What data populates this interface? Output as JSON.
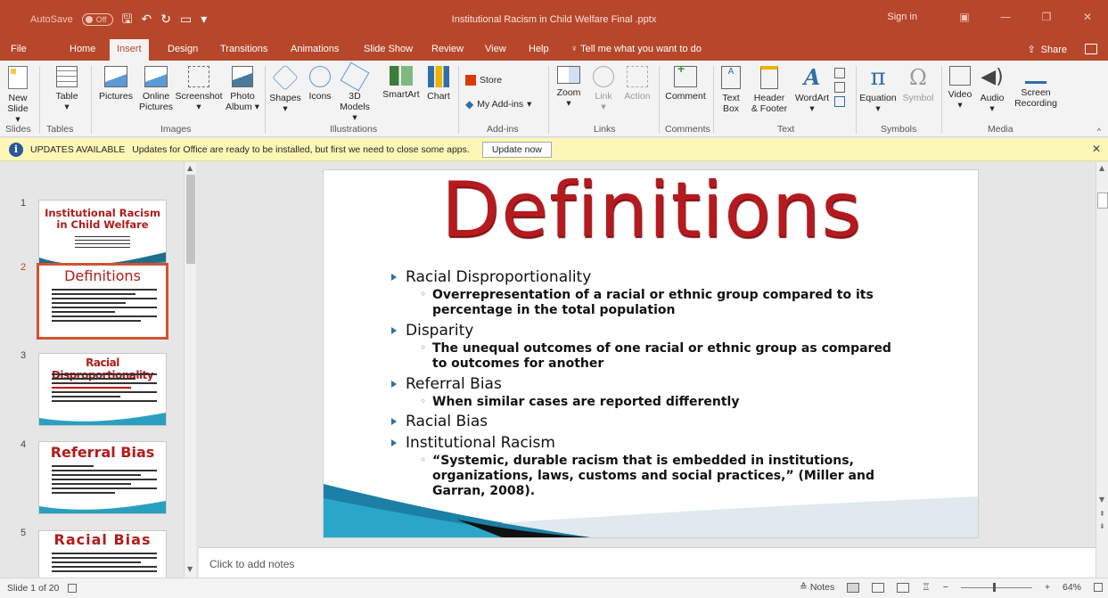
{
  "titlebar": {
    "autosave_label": "AutoSave",
    "autosave_state": "Off",
    "doc_title": "Institutional Racism in Child Welfare Final .pptx",
    "sign_in": "Sign in"
  },
  "tabs": [
    {
      "label": "File"
    },
    {
      "label": "Home"
    },
    {
      "label": "Insert",
      "active": true
    },
    {
      "label": "Design"
    },
    {
      "label": "Transitions"
    },
    {
      "label": "Animations"
    },
    {
      "label": "Slide Show"
    },
    {
      "label": "Review"
    },
    {
      "label": "View"
    },
    {
      "label": "Help"
    }
  ],
  "tell_me": "Tell me what you want to do",
  "share_label": "Share",
  "ribbon": {
    "new_slide_1": "New",
    "new_slide_2": "Slide",
    "table": "Table",
    "pictures": "Pictures",
    "online_pictures_1": "Online",
    "online_pictures_2": "Pictures",
    "screenshot": "Screenshot",
    "photo_album_1": "Photo",
    "photo_album_2": "Album",
    "shapes": "Shapes",
    "icons": "Icons",
    "models_1": "3D",
    "models_2": "Models",
    "smartart": "SmartArt",
    "chart": "Chart",
    "store": "Store",
    "my_addins": "My Add-ins",
    "zoom": "Zoom",
    "link": "Link",
    "action": "Action",
    "comment": "Comment",
    "textbox_1": "Text",
    "textbox_2": "Box",
    "header_1": "Header",
    "header_2": "& Footer",
    "wordart": "WordArt",
    "equation": "Equation",
    "symbol": "Symbol",
    "video": "Video",
    "audio": "Audio",
    "screen_rec_1": "Screen",
    "screen_rec_2": "Recording",
    "groups": {
      "slides": "Slides",
      "tables": "Tables",
      "images": "Images",
      "illustrations": "Illustrations",
      "addins": "Add-ins",
      "links": "Links",
      "comments": "Comments",
      "text": "Text",
      "symbols": "Symbols",
      "media": "Media"
    }
  },
  "update_bar": {
    "title": "UPDATES AVAILABLE",
    "message": "Updates for Office are ready to be installed, but first we need to close some apps.",
    "button": "Update now"
  },
  "thumbnails": [
    {
      "num": "1",
      "title": "Institutional Racism in Child Welfare"
    },
    {
      "num": "2",
      "title": "Definitions"
    },
    {
      "num": "3",
      "title": "Racial Disproportionality"
    },
    {
      "num": "4",
      "title": "Referral Bias"
    },
    {
      "num": "5",
      "title": "Racial Bias"
    }
  ],
  "slide": {
    "title": "Definitions",
    "b1": "Racial Disproportionality",
    "b1s": "Overrepresentation of a racial or ethnic group compared to its percentage in the total population",
    "b2": "Disparity",
    "b2s": "The unequal outcomes of one racial or ethnic group as compared to outcomes for another",
    "b3": "Referral Bias",
    "b3s": "When similar cases are reported differently",
    "b4": "Racial Bias",
    "b5": "Institutional Racism",
    "b5s": "“Systemic, durable racism that is embedded in institutions, organizations, laws, customs and social practices,” (Miller and Garran, 2008)."
  },
  "notes_placeholder": "Click to add notes",
  "status": {
    "slide_counter": "Slide 1 of 20",
    "notes_label": "Notes",
    "zoom_level": "64%"
  }
}
